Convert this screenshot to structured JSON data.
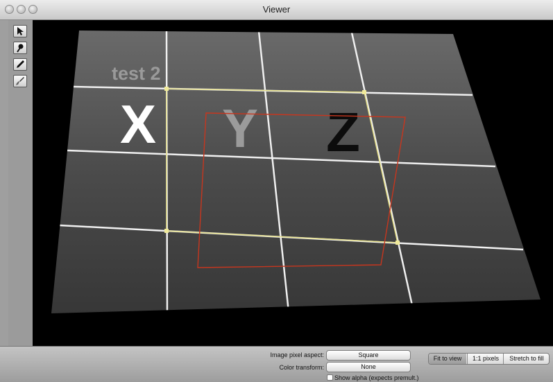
{
  "window": {
    "title": "Viewer"
  },
  "tools": [
    "arrow-tool-icon",
    "pin-tool-icon",
    "pen-tool-icon",
    "brush-tool-icon"
  ],
  "image": {
    "labels": {
      "test": "test 2",
      "x": "X",
      "y": "Y",
      "z": "Z"
    },
    "colors": {
      "grid": "#f0f0f0",
      "yellow_quad": "#e6e08a",
      "red_quad": "#c8361e",
      "surface": "#4a4a4a"
    }
  },
  "panel": {
    "pixel_aspect_label": "Image pixel aspect:",
    "pixel_aspect_value": "Square",
    "color_transform_label": "Color transform:",
    "color_transform_value": "None",
    "show_alpha_label": "Show alpha (expects premult.)",
    "show_alpha_checked": false,
    "fit_options": [
      "Fit to view",
      "1:1 pixels",
      "Stretch to fill"
    ],
    "fit_selected": "Fit to view"
  }
}
